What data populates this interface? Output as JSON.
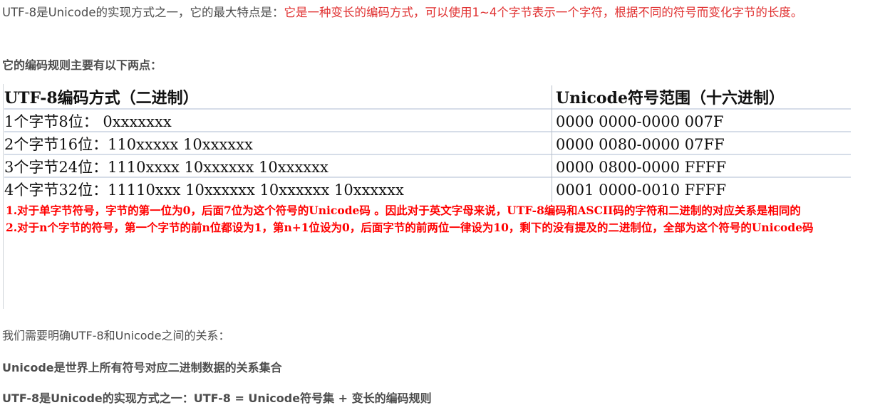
{
  "intro": {
    "plain": "UTF-8是Unicode的实现方式之一，它的最大特点是：",
    "highlight": "它是一种变长的编码方式，可以使用1~4个字节表示一个字符，根据不同的符号而变化字节的长度。"
  },
  "rules_heading": "它的编码规则主要有以下两点：",
  "table": {
    "headers": [
      "UTF-8编码方式（二进制）",
      "Unicode符号范围（十六进制）"
    ],
    "rows": [
      [
        "1个字节8位：  0xxxxxxx",
        "0000 0000-0000 007F"
      ],
      [
        "2个字节16位：110xxxxx 10xxxxxx",
        "0000 0080-0000 07FF"
      ],
      [
        "3个字节24位：1110xxxx 10xxxxxx 10xxxxxx",
        "0000 0800-0000 FFFF"
      ],
      [
        "4个字节32位：11110xxx 10xxxxxx 10xxxxxx 10xxxxxx",
        "0001 0000-0010 FFFF"
      ]
    ],
    "notes": [
      "1.对于单字节符号，字节的第一位为0，后面7位为这个符号的Unicode码 。因此对于英文字母来说，UTF-8编码和ASCII码的字符和二进制的对应关系是相同的",
      "2.对于n个字节的符号，第一个字节的前n位都设为1，第n+1位设为0，后面字节的前两位一律设为10，剩下的没有提及的二进制位，全部为这个符号的Unicode码"
    ]
  },
  "relation_intro": "我们需要明确UTF-8和Unicode之间的关系：",
  "statement1": "Unicode是世界上所有符号对应二进制数据的关系集合",
  "statement2": "UTF-8是Unicode的实现方式之一：UTF-8 = Unicode符号集 + 变长的编码规则",
  "colors": {
    "text": "#4d4d4d",
    "highlight": "#e03131",
    "notes": "#ff0000"
  }
}
